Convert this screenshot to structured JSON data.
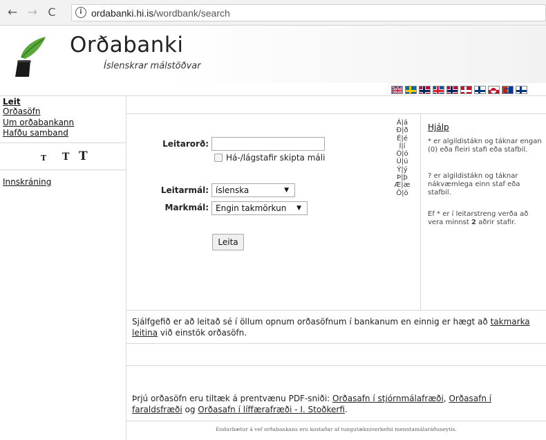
{
  "browser": {
    "back_icon": "←",
    "forward_icon": "→",
    "reload_icon": "C",
    "info_icon": "i",
    "url_host": "ordabanki.hi.is",
    "url_path": "/wordbank/search"
  },
  "header": {
    "title": "Orðabanki",
    "subtitle": "Íslenskrar málstöðvar"
  },
  "flags": [
    "gb",
    "se",
    "no",
    "is",
    "no",
    "dk",
    "fi",
    "gl",
    "fo",
    "fi"
  ],
  "nav": {
    "items": [
      {
        "label": "Leit",
        "active": true
      },
      {
        "label": "Orðasöfn",
        "active": false
      },
      {
        "label": "Um orðabankann",
        "active": false
      },
      {
        "label": "Hafðu samband",
        "active": false
      }
    ],
    "font_small": "T",
    "font_medium": "T",
    "font_large": "T",
    "login": "Innskráning"
  },
  "search": {
    "term_label": "Leitarorð:",
    "term_value": "",
    "case_label": "Há-/lágstafir skipta máli",
    "source_label": "Leitarmál:",
    "source_value": "íslenska",
    "target_label": "Markmál:",
    "target_value": "Engin takmörkun",
    "button_label": "Leita"
  },
  "special_chars": [
    "Á|á",
    "Ð|ð",
    "É|é",
    "Í|í",
    "Ó|ó",
    "Ú|ú",
    "Ý|ý",
    "Þ|þ",
    "Æ|æ",
    "Ö|ö"
  ],
  "help": {
    "title": "Hjálp",
    "p1": "* er algildistákn og táknar engan (0) eða fleiri stafi eða stafbil.",
    "p2": "? er algildistákn og táknar nákvæmlega einn staf eða stafbil.",
    "p3_pre": "Ef * er í leitarstreng verða að vera minnst ",
    "p3_num": "2",
    "p3_post": " aðrir stafir."
  },
  "info": {
    "default_text": "Sjálfgefið er að leitað sé í öllum opnum orðasöfnum í bankanum en einnig er hægt að ",
    "default_link": "takmarka leitina",
    "default_post": " við einstök orðasöfn.",
    "pdf_pre": "Þrjú orðasöfn eru tiltæk á prentvænu PDF-sniði: ",
    "pdf_link1": "Orðasafn í stjórnmálafræði",
    "pdf_sep1": ", ",
    "pdf_link2": "Orðasafn í faraldsfræði",
    "pdf_sep2": " og ",
    "pdf_link3": "Orðasafn í líffærafræði - I. Stoðkerfi",
    "pdf_post": "."
  },
  "footer": "Endurbætur á vef orðabankans eru kostaðar af tungutækniverkefni menntamálaráðuneytis."
}
